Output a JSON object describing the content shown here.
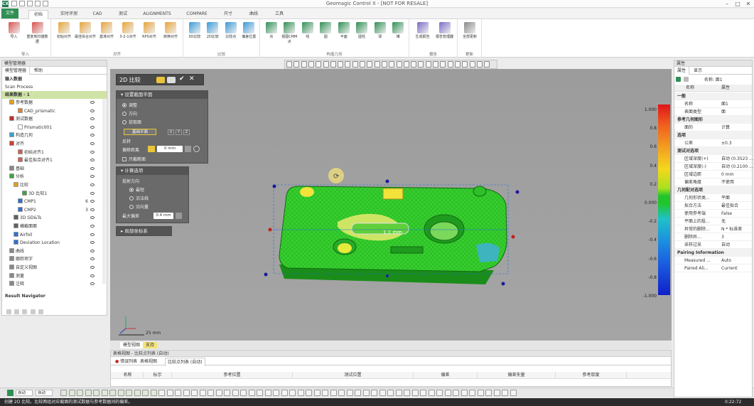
{
  "app": {
    "title": "Geomagic Control X - [NOT FOR RESALE]",
    "icon_label": "CX"
  },
  "colors": {
    "accent_green": "#2f8f54",
    "viewport_bg": "#a0a0a0",
    "part_green": "#33cc33",
    "statusbar": "#2c2c2c"
  },
  "ribbon_tabs": [
    {
      "label": "文件",
      "kind": "file"
    },
    {
      "label": "初始",
      "kind": "active"
    },
    {
      "label": "实时评测",
      "kind": ""
    },
    {
      "label": "CAD",
      "kind": ""
    },
    {
      "label": "测试",
      "kind": ""
    },
    {
      "label": "ALIGNMENTS",
      "kind": ""
    },
    {
      "label": "COMPARE",
      "kind": ""
    },
    {
      "label": "尺寸",
      "kind": ""
    },
    {
      "label": "曲线",
      "kind": ""
    },
    {
      "label": "工具",
      "kind": ""
    }
  ],
  "ribbon_groups": [
    {
      "label": "导入",
      "buttons": [
        "导入",
        "重复到扫描数据"
      ]
    },
    {
      "label": "对齐",
      "buttons": [
        "初始对齐",
        "最佳拟合对齐",
        "基准对齐",
        "3-2-1对齐",
        "RPS对齐",
        "转换对齐"
      ]
    },
    {
      "label": "比较",
      "buttons": [
        "3D比较",
        "2D比较",
        "比较点",
        "偏差位置"
      ]
    },
    {
      "label": "构造几何",
      "buttons": [
        "点",
        "视图CMM点",
        "线",
        "圆",
        "平面",
        "圆柱",
        "球",
        "锥"
      ]
    },
    {
      "label": "报告",
      "buttons": [
        "生成报告",
        "报告管理器"
      ]
    },
    {
      "label": "更新",
      "buttons": [
        "全部更新"
      ]
    }
  ],
  "left_panel": {
    "header": "模型管理器",
    "tabs": [
      "模型管理器",
      "帮助"
    ],
    "section_input": "输入数据",
    "scan_process": "Scan Process",
    "result_data": "结果数据 - 1",
    "tree": [
      {
        "label": "参考数据",
        "indent": 1,
        "icon": "#e0a020",
        "num": ""
      },
      {
        "label": "CAD_prismatic",
        "indent": 3,
        "icon": "#e08030",
        "num": ""
      },
      {
        "label": "测试数据",
        "indent": 1,
        "icon": "#c03030",
        "num": ""
      },
      {
        "label": "Prismatic001",
        "indent": 3,
        "icon": "#ffffff",
        "num": ""
      },
      {
        "label": "构造几何",
        "indent": 1,
        "icon": "#3aa0d0",
        "num": ""
      },
      {
        "label": "对齐",
        "indent": 1,
        "icon": "#d04030",
        "num": ""
      },
      {
        "label": "初始对齐1",
        "indent": 3,
        "icon": "#d06050",
        "num": ""
      },
      {
        "label": "最佳拟合对齐1",
        "indent": 3,
        "icon": "#d06050",
        "num": ""
      },
      {
        "label": "基础",
        "indent": 1,
        "icon": "#888888",
        "num": ""
      },
      {
        "label": "分析",
        "indent": 1,
        "icon": "#40a040",
        "num": ""
      },
      {
        "label": "比较",
        "indent": 2,
        "icon": "#e0a020",
        "num": ""
      },
      {
        "label": "3D 比较1",
        "indent": 4,
        "icon": "#40a040",
        "num": ""
      },
      {
        "label": "CMP1",
        "indent": 3,
        "icon": "#3070d0",
        "num": "6"
      },
      {
        "label": "CMP2",
        "indent": 3,
        "icon": "#3070d0",
        "num": "3"
      },
      {
        "label": "3D GD&Ts",
        "indent": 2,
        "icon": "#606060",
        "num": ""
      },
      {
        "label": "横截面面",
        "indent": 2,
        "icon": "#606060",
        "num": ""
      },
      {
        "label": "Airfoil",
        "indent": 2,
        "icon": "#3070d0",
        "num": ""
      },
      {
        "label": "Deviation Location",
        "indent": 2,
        "icon": "#3070d0",
        "num": ""
      },
      {
        "label": "曲线",
        "indent": 1,
        "icon": "#888888",
        "num": ""
      },
      {
        "label": "跟踪项字",
        "indent": 1,
        "icon": "#888888",
        "num": ""
      },
      {
        "label": "自定义视图",
        "indent": 1,
        "icon": "#888888",
        "num": ""
      },
      {
        "label": "测量",
        "indent": 1,
        "icon": "#888888",
        "num": ""
      },
      {
        "label": "注释",
        "indent": 1,
        "icon": "#888888",
        "num": ""
      }
    ],
    "result_navigator": "Result Navigator"
  },
  "dialog": {
    "title": "2D 比较",
    "section1": "设置截面平面",
    "radio1": [
      "调整",
      "方向",
      "拾取面"
    ],
    "plane_button": "基础平面",
    "axis_labels": [
      "X",
      "Y",
      "Z"
    ],
    "offset_label": "偏移距离",
    "offset_value": "0 mm",
    "reverse_label": "反转",
    "checkbox_label": "只截断面",
    "section2": "计算选项",
    "dir_label": "投射方向",
    "radio2": [
      "最短",
      "沿法线",
      "沿向量"
    ],
    "max_label": "最大偏差",
    "max_value": "0.4 mm",
    "section3": "局部坐标系"
  },
  "viewport": {
    "scale_label": "25 mm",
    "tabs": [
      "模型视图",
      "支持"
    ],
    "annotation": "1.1 mm",
    "colorbar_ticks": [
      "1.000",
      "0.8",
      "0.6",
      "0.4",
      "0.2",
      "0.000",
      "-0.2",
      "-0.4",
      "-0.6",
      "-0.8",
      "-1.000"
    ]
  },
  "bottom_panel": {
    "title": "表格视图 - 比较点列表 (自动)",
    "tabs": [
      "错误列表",
      "表格视图",
      "比较点列表 (自动)"
    ],
    "columns": [
      "名称",
      "标示",
      "参考位置",
      "测试位置",
      "偏差",
      "偏差矢量",
      "参考厚度"
    ]
  },
  "right_panel": {
    "header": "属性",
    "tabs": [
      "属性",
      "显示"
    ],
    "name_label": "名称: 面1",
    "col_name": "名称",
    "col_value": "属性",
    "rows": [
      {
        "kind": "group",
        "k": "一般",
        "v": ""
      },
      {
        "kind": "row",
        "k": "名称",
        "v": "面1"
      },
      {
        "kind": "row",
        "k": "表面类型",
        "v": "面"
      },
      {
        "kind": "group",
        "k": "参考几何图形",
        "v": ""
      },
      {
        "kind": "row",
        "k": "面的",
        "v": "计算"
      },
      {
        "kind": "group",
        "k": "选项",
        "v": ""
      },
      {
        "kind": "row",
        "k": "公差",
        "v": "±0.3"
      },
      {
        "kind": "group",
        "k": "测试对选项",
        "v": ""
      },
      {
        "kind": "row",
        "k": "区域深度(+)",
        "v": "自动 (0.3523 ..."
      },
      {
        "kind": "row",
        "k": "区域深度(-)",
        "v": "自动 (0.2100 ..."
      },
      {
        "kind": "row",
        "k": "区域边距",
        "v": "0 mm"
      },
      {
        "kind": "row",
        "k": "偏差角度",
        "v": "不使用"
      },
      {
        "kind": "group",
        "k": "几何配对选项",
        "v": ""
      },
      {
        "kind": "row",
        "k": "几何形状类...",
        "v": "平面"
      },
      {
        "kind": "row",
        "k": "拟合方法",
        "v": "最佳拟合"
      },
      {
        "kind": "row",
        "k": "使用参考端",
        "v": "False"
      },
      {
        "kind": "row",
        "k": "平面上的投...",
        "v": "无"
      },
      {
        "kind": "row",
        "k": "异常的删除...",
        "v": "N * 标准差"
      },
      {
        "kind": "row",
        "k": "删除异...",
        "v": "3"
      },
      {
        "kind": "row",
        "k": "采样过采",
        "v": "自动"
      },
      {
        "kind": "group",
        "k": "Pairing Information",
        "v": ""
      },
      {
        "kind": "row",
        "k": "Measured ...",
        "v": "Auto"
      },
      {
        "kind": "row",
        "k": "Paired Ali...",
        "v": "Current"
      }
    ]
  },
  "bottom_tools": {
    "combo1": "自动",
    "combo2": "自动"
  },
  "statusbar": {
    "text": "创建 2D 比较。比较两组对应截面的测试数据与参考数据间的偏差。",
    "time": "0:22:72"
  }
}
